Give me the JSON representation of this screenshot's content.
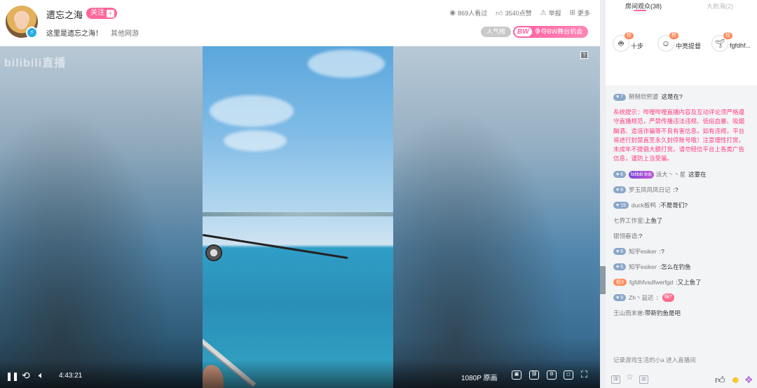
{
  "header": {
    "streamer_name": "遗忘之海",
    "follow_label": "关注",
    "follow_plus": "+",
    "room_title": "这里是遗忘之海！",
    "room_category": "其他网游",
    "views": "869人看过",
    "likes": "3540点赞",
    "report": "举报",
    "more": "更多",
    "hot_rank": "人气榜",
    "bw_logo": "BW",
    "bw_text": "争夺BW舞台机会"
  },
  "player": {
    "watermark": "bilibili直播",
    "help": "?",
    "time": "4:43:21",
    "quality": "1080P 原画"
  },
  "side": {
    "tab_audience": "房间观众(38)",
    "tab_captains": "大航海(2)",
    "top_viewers": [
      {
        "rank": "榜1",
        "name": "十步",
        "icon": "robot-avatar"
      },
      {
        "rank": "榜2",
        "name": "中亮提督",
        "icon": "character-avatar"
      },
      {
        "rank": "榜3",
        "name": "fgfdhf...",
        "icon": "plant-avatar"
      }
    ],
    "messages": [
      {
        "type": "user",
        "level": "7",
        "name": "掰掰欣熙婆",
        "text": "这是在?"
      },
      {
        "type": "system",
        "text": "系统提示：哔哩哔哩直播内容及互动评论须严格遵守直播规范，严禁传播违法违规、低俗血暴、吸烟酗酒、造谣诈骗等不良有害信息。如有违规，平台将进行封禁直至永久封停账号哦！注意理性打赏，未成年不提倡大额打赏。请勿轻信平台上各类广告信息，谨防上当受骗。"
      },
      {
        "type": "user",
        "level": "6",
        "badge": "bilibili link",
        "name": "派大丶丶星",
        "text": "这要在"
      },
      {
        "type": "user",
        "level": "8",
        "name": "罗玉凤凤凤日记",
        "text": ":?"
      },
      {
        "type": "user",
        "level": "19",
        "name": "duck板鸭",
        "text": ":不是哥们?"
      },
      {
        "type": "plain",
        "name": "七界工作室",
        "text": ":上鱼了"
      },
      {
        "type": "plain",
        "name": "银翎春语",
        "text": ":?"
      },
      {
        "type": "user",
        "level": "6",
        "name": "知宇esiker",
        "text": ":?"
      },
      {
        "type": "user",
        "level": "6",
        "name": "知宇esiker",
        "text": ":怎么在钓鱼"
      },
      {
        "type": "rank",
        "level": "榜3",
        "name": "fgfdhfvsdfwerfgd",
        "text": ":又上鱼了"
      },
      {
        "type": "user",
        "level": "9",
        "name": "Zh丶益达",
        "text": ":",
        "sticker": "啊?"
      },
      {
        "type": "plain",
        "name": "王山而末崽",
        "text": ":带新钓鱼是吧"
      }
    ],
    "enter_notice": "记录游戏生活的小a 进入直播间"
  },
  "colors": {
    "accent_pink": "#ff6699",
    "level_blue": "#8aa7c9",
    "rank_orange": "#ff8a5a",
    "system_red": "#ff3f7f"
  }
}
